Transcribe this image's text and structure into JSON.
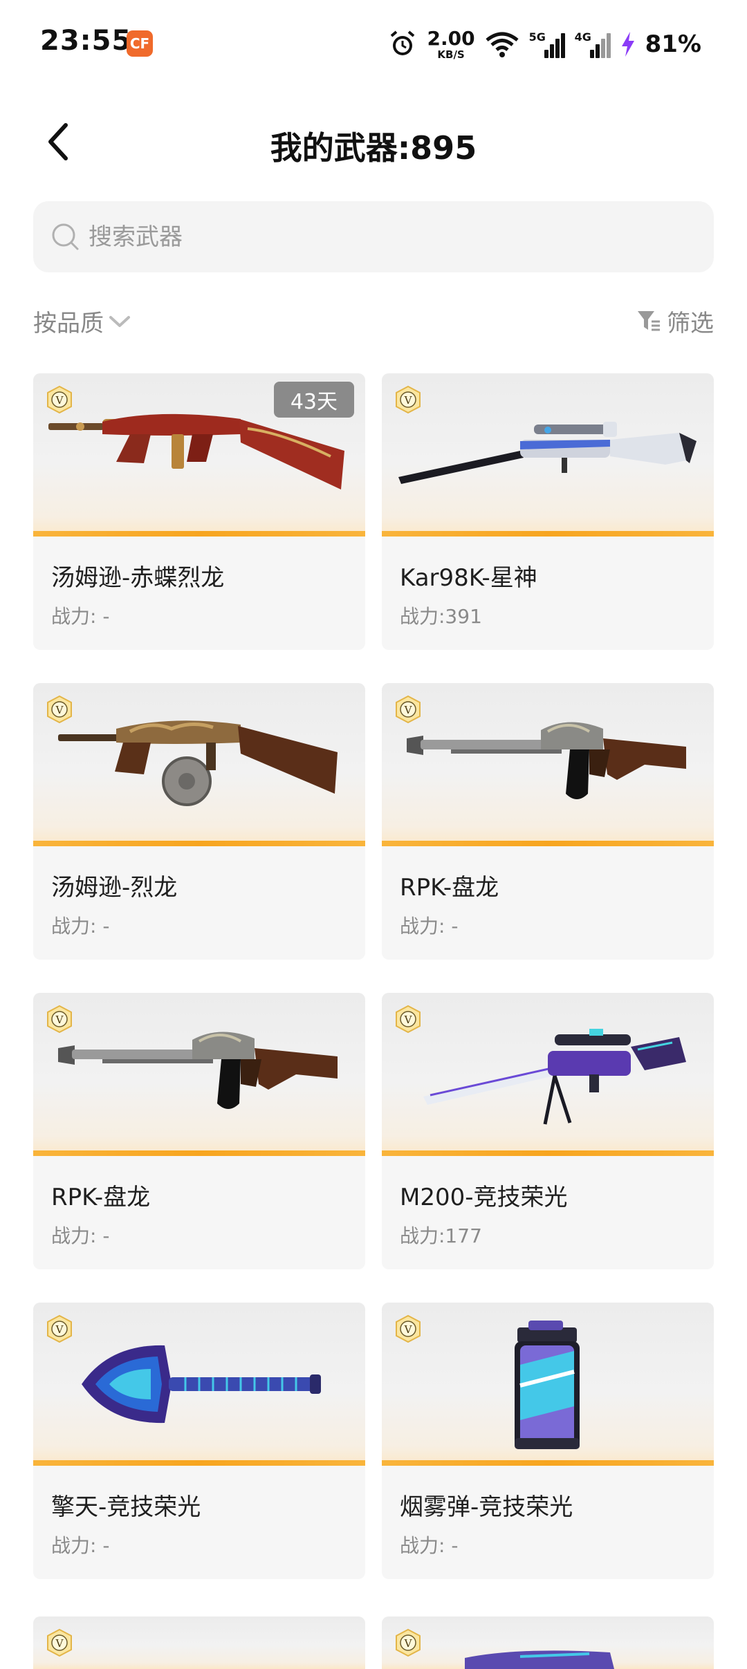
{
  "status_bar": {
    "time": "23:55",
    "app_icon_text": "CF",
    "net_speed_value": "2.00",
    "net_speed_unit": "KB/S",
    "sim1_label": "5G",
    "sim2_label": "4G",
    "battery": "81%"
  },
  "header": {
    "title": "我的武器:895"
  },
  "search": {
    "placeholder": "搜索武器"
  },
  "toolbar": {
    "sort_label": "按品质",
    "filter_label": "筛选"
  },
  "badge_letter": "V",
  "weapons": [
    {
      "name": "汤姆逊-赤蝶烈龙",
      "power": "战力: -",
      "days": "43天"
    },
    {
      "name": "Kar98K-星神",
      "power": "战力:391"
    },
    {
      "name": "汤姆逊-烈龙",
      "power": "战力: -"
    },
    {
      "name": "RPK-盘龙",
      "power": "战力: -"
    },
    {
      "name": "RPK-盘龙",
      "power": "战力: -"
    },
    {
      "name": "M200-竞技荣光",
      "power": "战力:177"
    },
    {
      "name": "擎天-竞技荣光",
      "power": "战力: -"
    },
    {
      "name": "烟雾弹-竞技荣光",
      "power": "战力: -"
    }
  ],
  "colors": {
    "accent_stripe": "#f7a51f",
    "card_bg": "#f6f6f6",
    "muted_text": "#8a8a8a"
  }
}
